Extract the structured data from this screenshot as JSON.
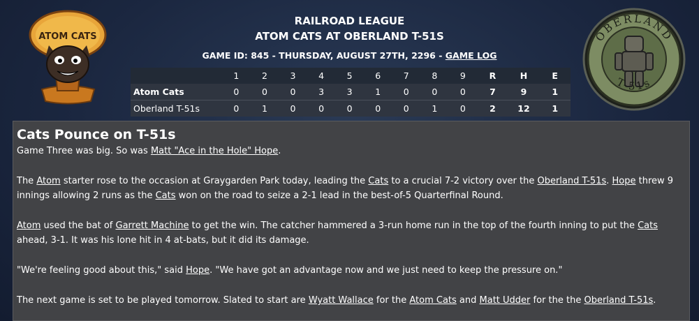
{
  "header": {
    "league": "RAILROAD LEAGUE",
    "matchup": "ATOM CATS AT OBERLAND T-51S",
    "game_info": "GAME ID: 845 - THURSDAY, AUGUST 27TH, 2296 - ",
    "game_log_link": "GAME LOG"
  },
  "logos": {
    "left_text": "ATOM CATS",
    "right_text": "OBERLAND T-51s"
  },
  "boxscore": {
    "headers": [
      "1",
      "2",
      "3",
      "4",
      "5",
      "6",
      "7",
      "8",
      "9",
      "R",
      "H",
      "E"
    ],
    "rows": [
      {
        "team": "Atom Cats",
        "innings": [
          "0",
          "0",
          "0",
          "3",
          "3",
          "1",
          "0",
          "0",
          "0"
        ],
        "r": "7",
        "h": "9",
        "e": "1"
      },
      {
        "team": "Oberland T-51s",
        "innings": [
          "0",
          "1",
          "0",
          "0",
          "0",
          "0",
          "0",
          "1",
          "0"
        ],
        "r": "2",
        "h": "12",
        "e": "1"
      }
    ]
  },
  "article": {
    "headline": "Cats Pounce on T-51s",
    "p1": {
      "a": "Game Three was big. So was ",
      "link": "Matt \"Ace in the Hole\" Hope",
      "b": "."
    },
    "p2": {
      "t1": "The ",
      "l1": "Atom",
      "t2": " starter rose to the occasion at Graygarden Park today, leading the ",
      "l2": "Cats",
      "t3": " to a crucial 7-2 victory over the ",
      "l3": "Oberland T-51s",
      "t4": ". ",
      "l4": "Hope",
      "t5": " threw 9 innings allowing 2 runs as the ",
      "l5": "Cats",
      "t6": " won on the road to seize a 2-1 lead in the best-of-5 Quarterfinal Round."
    },
    "p3": {
      "l1": "Atom",
      "t1": " used the bat of ",
      "l2": "Garrett Machine",
      "t2": " to get the win. The catcher hammered a 3-run home run in the top of the fourth inning to put the ",
      "l3": "Cats",
      "t3": " ahead, 3-1. It was his lone hit in 4 at-bats, but it did its damage."
    },
    "p4": {
      "t1": "\"We're feeling good about this,\" said ",
      "l1": "Hope",
      "t2": ". \"We have got an advantage now and we just need to keep the pressure on.\""
    },
    "p5": {
      "t1": "The next game is set to be played tomorrow. Slated to start are ",
      "l1": "Wyatt Wallace",
      "t2": " for the ",
      "l2": "Atom Cats",
      "t3": " and ",
      "l3": "Matt Udder",
      "t4": " for the the ",
      "l4": "Oberland T-51s",
      "t5": "."
    }
  },
  "colors": {
    "accent_orange": "#e58a2a",
    "text": "#ffffff",
    "panel": "#424346"
  }
}
